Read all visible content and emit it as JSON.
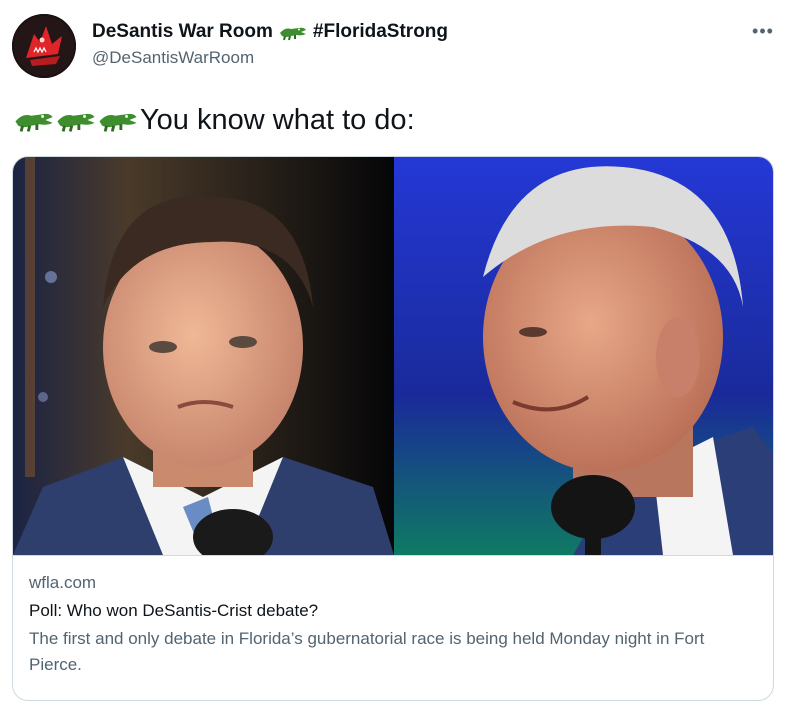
{
  "author": {
    "display_name": "DeSantis War Room",
    "hashtag": "#FloridaStrong",
    "handle": "@DeSantisWarRoom",
    "avatar_icon": "red-alligator-head-icon",
    "name_emoji_icon": "alligator-emoji-icon"
  },
  "menu": {
    "more_label": "•••"
  },
  "tweet": {
    "emoji_icons": [
      "alligator-emoji-icon",
      "alligator-emoji-icon",
      "alligator-emoji-icon"
    ],
    "text": "You know what to do:"
  },
  "card": {
    "image_icon": "debate-candidates-photo",
    "domain": "wfla.com",
    "title": "Poll: Who won DeSantis-Crist debate?",
    "description": "The first and only debate in Florida’s gubernatorial race is being held Monday night in Fort Pierce."
  },
  "colors": {
    "text_primary": "#0f1419",
    "text_secondary": "#536471",
    "border": "#cfd9de",
    "gator_green": "#3e8e2f"
  }
}
